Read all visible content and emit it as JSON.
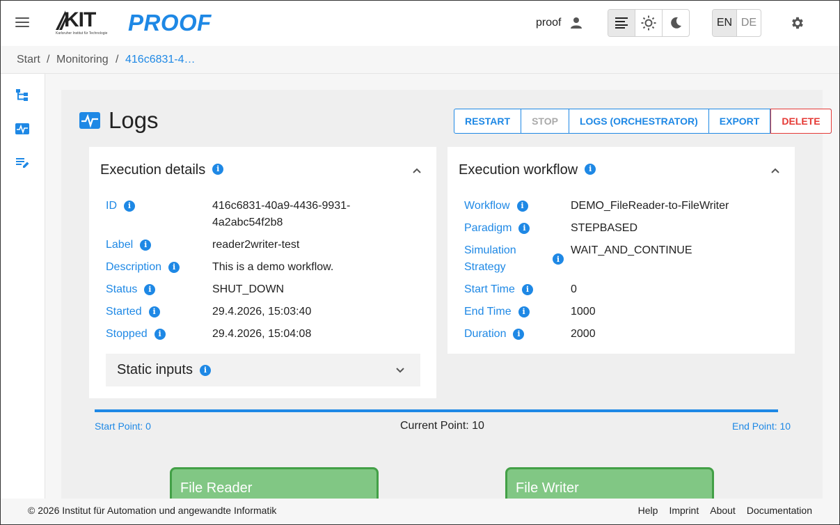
{
  "header": {
    "app_title": "PROOF",
    "logo_text": "KIT",
    "logo_subtitle": "Karlsruher Institut für Technologie",
    "user": "proof",
    "languages": [
      "EN",
      "DE"
    ],
    "active_language": "EN",
    "theme_modes": [
      "list-icon",
      "light-mode-icon",
      "dark-mode-icon"
    ],
    "active_theme": "list-icon"
  },
  "breadcrumb": [
    "Start",
    "Monitoring",
    "416c6831-4…"
  ],
  "page": {
    "title": "Logs",
    "actions": [
      "RESTART",
      "STOP",
      "LOGS (ORCHESTRATOR)",
      "EXPORT",
      "DELETE"
    ],
    "disabled_actions": [
      "STOP"
    ]
  },
  "execution_details": {
    "title": "Execution details",
    "fields": [
      {
        "label": "ID",
        "value": "416c6831-40a9-4436-9931-\n4a2abc54f2b8"
      },
      {
        "label": "Label",
        "value": "reader2writer-test"
      },
      {
        "label": "Description",
        "value": "This is a demo workflow."
      },
      {
        "label": "Status",
        "value": "SHUT_DOWN"
      },
      {
        "label": "Started",
        "value": "29.4.2026, 15:03:40"
      },
      {
        "label": "Stopped",
        "value": "29.4.2026, 15:04:08"
      }
    ],
    "static_inputs_label": "Static inputs"
  },
  "execution_workflow": {
    "title": "Execution workflow",
    "fields": [
      {
        "label": "Workflow",
        "value": "DEMO_FileReader-to-FileWriter"
      },
      {
        "label": "Paradigm",
        "value": "STEPBASED"
      },
      {
        "label": "Simulation\nStrategy",
        "value": "WAIT_AND_CONTINUE"
      },
      {
        "label": "Start Time",
        "value": "0"
      },
      {
        "label": "End Time",
        "value": "1000"
      },
      {
        "label": "Duration",
        "value": "2000"
      }
    ]
  },
  "progress": {
    "start_label": "Start Point: 0",
    "current_label": "Current Point: 10",
    "end_label": "End Point: 10",
    "fraction": 1.0
  },
  "nodes": [
    "File Reader",
    "File Writer"
  ],
  "footer": {
    "copyright": "© 2026 Institut für Automation und angewandte Informatik",
    "links": [
      "Help",
      "Imprint",
      "About",
      "Documentation"
    ]
  },
  "colors": {
    "accent": "#1e88e5",
    "danger": "#e53935",
    "node_fill": "#81c784",
    "node_border": "#43a047"
  }
}
